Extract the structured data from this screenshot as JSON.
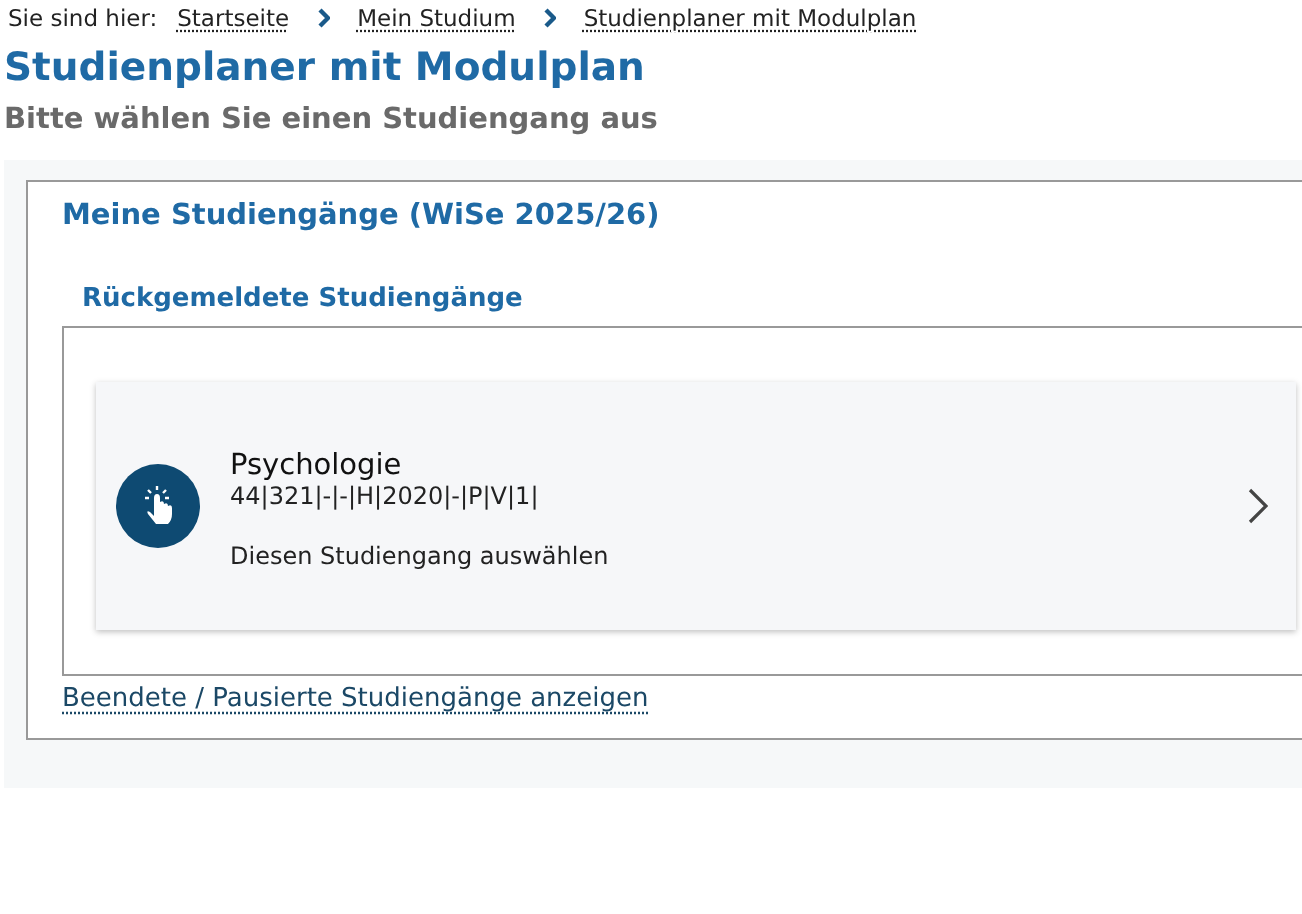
{
  "breadcrumb": {
    "label": "Sie sind hier:",
    "items": [
      "Startseite",
      "Mein Studium",
      "Studienplaner mit Modulplan"
    ]
  },
  "title": "Studienplaner mit Modulplan",
  "subtitle": "Bitte wählen Sie einen Studiengang aus",
  "section": {
    "title": "Meine Studiengänge (WiSe 2025/26)",
    "group_title": "Rückgemeldete Studiengänge",
    "programs": [
      {
        "name": "Psychologie",
        "code": "44|321|-|-|H|2020|-|P|V|1|",
        "action": "Diesen Studiengang auswählen"
      }
    ],
    "link": "Beendete / Pausierte Studiengänge anzeigen"
  }
}
